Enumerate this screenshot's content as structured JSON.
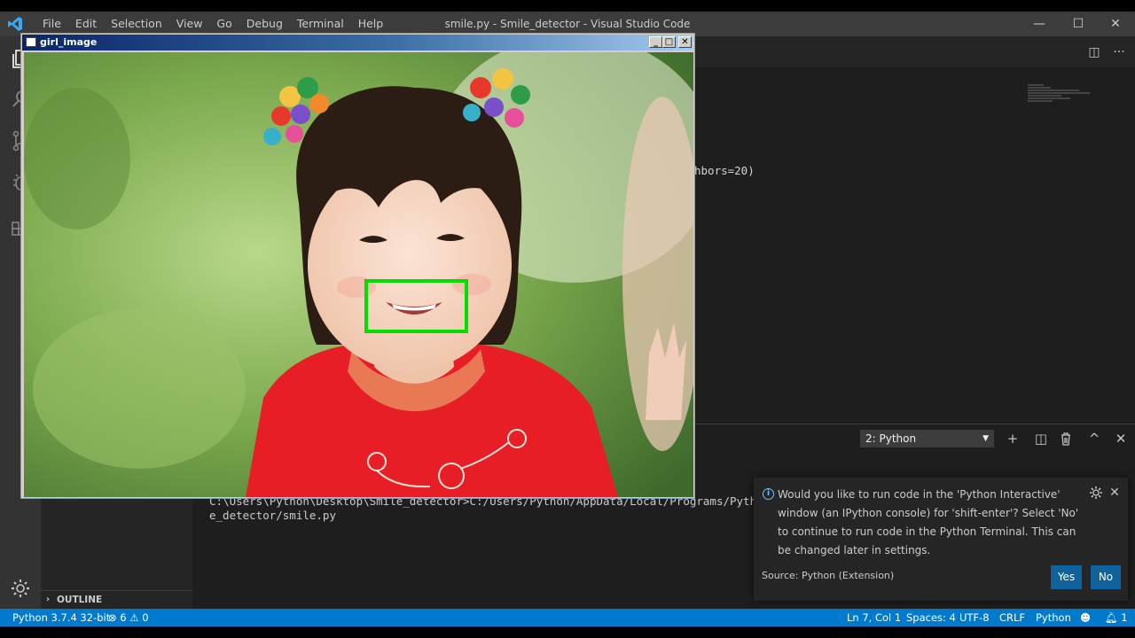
{
  "window": {
    "title": "smile.py - Smile_detector - Visual Studio Code",
    "controls": {
      "minimize": "—",
      "maximize": "☐",
      "close": "✕"
    }
  },
  "menu": [
    "File",
    "Edit",
    "Selection",
    "View",
    "Go",
    "Debug",
    "Terminal",
    "Help"
  ],
  "activity_icons": [
    "explorer-icon",
    "search-icon",
    "source-control-icon",
    "debug-icon",
    "extensions-icon",
    "settings-gear-icon"
  ],
  "editor": {
    "visible_code": "hbors=20)",
    "actions": {
      "split": "◫",
      "more": "···"
    }
  },
  "sidebar": {
    "outline_label": "OUTLINE"
  },
  "panel": {
    "terminal_selected": "2: Python",
    "actions": {
      "add": "+",
      "split": "◫",
      "trash": "🗑",
      "maximize": "^",
      "close": "✕"
    },
    "terminal_lines": [
      "C:\\Users\\Python\\Desktop\\Smile_detector>C:/Users/Python/AppData/Local/Programs/Pyth",
      "e_detector/smile.py"
    ]
  },
  "notification": {
    "message": "Would you like to run code in the 'Python Interactive' window (an IPython console) for 'shift-enter'? Select 'No' to continue to run code in the Python Terminal. This can be changed later in settings.",
    "source": "Source: Python (Extension)",
    "yes_label": "Yes",
    "no_label": "No"
  },
  "cv_window": {
    "title": "girl_image",
    "buttons": {
      "minimize": "_",
      "maximize": "□",
      "close": "✕"
    },
    "detection_box_color": "#00e000"
  },
  "statusbar": {
    "interpreter": "Python 3.7.4 32-bit",
    "errors": "6",
    "warnings": "0",
    "position": "Ln 7, Col 1",
    "spaces": "Spaces: 4",
    "encoding": "UTF-8",
    "eol": "CRLF",
    "language": "Python",
    "notifications": "1"
  },
  "colors": {
    "statusbar": "#007acc",
    "titlebar": "#3c3c3c",
    "activitybar": "#333333",
    "button": "#0e639c"
  }
}
